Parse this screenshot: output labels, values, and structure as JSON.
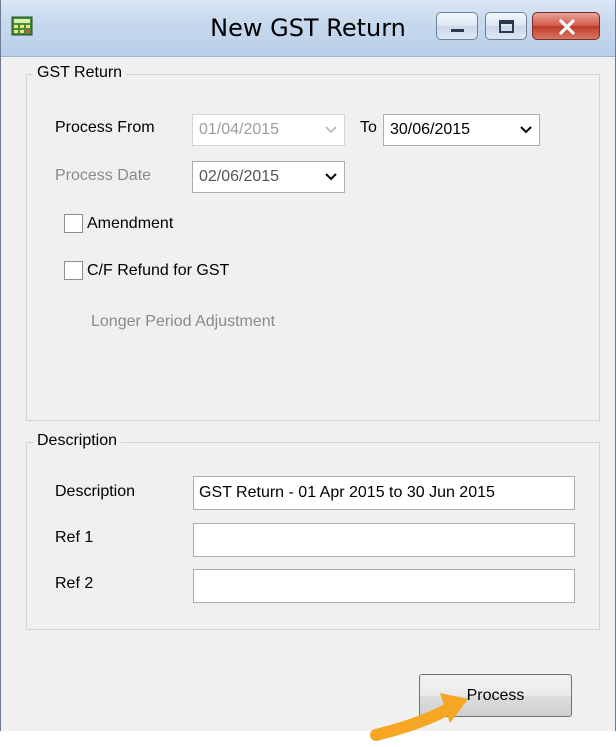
{
  "window": {
    "title": "New GST Return",
    "app_icon": "calculator-icon"
  },
  "gst_return_group": {
    "legend": "GST Return",
    "process_from_label": "Process From",
    "process_from_value": "01/04/2015",
    "to_label": "To",
    "to_value": "30/06/2015",
    "process_date_label": "Process Date",
    "process_date_value": "02/06/2015",
    "amendment_label": "Amendment",
    "cf_refund_label": "C/F Refund for GST",
    "longer_period_label": "Longer Period Adjustment"
  },
  "description_group": {
    "legend": "Description",
    "description_label": "Description",
    "description_value": "GST Return - 01 Apr 2015 to 30 Jun 2015",
    "ref1_label": "Ref 1",
    "ref1_value": "",
    "ref2_label": "Ref 2",
    "ref2_value": ""
  },
  "actions": {
    "process_label": "Process"
  },
  "colors": {
    "pointer_arrow": "#f5a623",
    "title_bar": "#c6d8ee",
    "close_button": "#c8483a"
  }
}
